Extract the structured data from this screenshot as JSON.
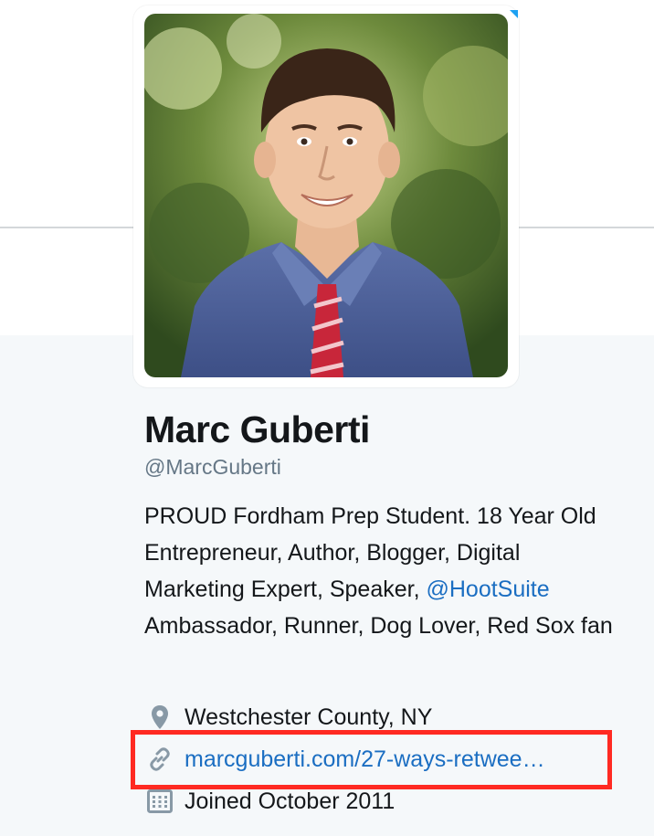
{
  "profile": {
    "name": "Marc Guberti",
    "handle": "@MarcGuberti",
    "bio_prefix": "PROUD Fordham Prep Student. 18 Year Old Entrepreneur, Author, Blogger, Digital Marketing Expert, Speaker, ",
    "bio_mention": "@HootSuite",
    "bio_suffix": " Ambassador, Runner, Dog Lover, Red Sox fan"
  },
  "meta": {
    "location": "Westchester County, NY",
    "location_icon": "location-pin-icon",
    "url": "marcguberti.com/27-ways-retwee…",
    "url_icon": "link-icon",
    "joined": "Joined October 2011",
    "joined_icon": "calendar-icon"
  },
  "colors": {
    "link": "#1b6ec2",
    "highlight": "#ff2a22",
    "accent": "#1da1f2"
  }
}
